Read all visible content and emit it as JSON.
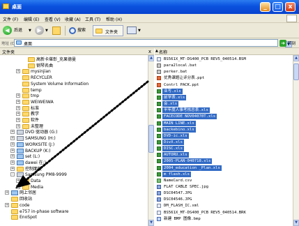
{
  "window": {
    "title": "桌面",
    "minimize_glyph": "_",
    "maximize_glyph": "□",
    "close_glyph": "x"
  },
  "menu": [
    "文件 (F)",
    "编辑 (E)",
    "查看 (V)",
    "收藏 (A)",
    "工具 (T)",
    "帮助 (H)"
  ],
  "toolbar": {
    "back_label": "后退",
    "search_label": "搜索",
    "folders_label": "文件夹"
  },
  "address": {
    "label": "地址 (D)",
    "value": "桌面",
    "go_label": "转到"
  },
  "folders_pane": {
    "title": "文件夹",
    "close_glyph": "x"
  },
  "tree": [
    {
      "label": "高新卡堪彰_充果德曼",
      "depth": 5,
      "icon": "folder",
      "expander": ""
    },
    {
      "label": "钢琴名曲",
      "depth": 5,
      "icon": "folder",
      "expander": ""
    },
    {
      "label": "mysinjian",
      "depth": 4,
      "icon": "folder",
      "expander": "+"
    },
    {
      "label": "RECYCLER",
      "depth": 4,
      "icon": "folder",
      "expander": ""
    },
    {
      "label": "System Volume Information",
      "depth": 4,
      "icon": "folder",
      "expander": ""
    },
    {
      "label": "temp",
      "depth": 4,
      "icon": "folder",
      "expander": ""
    },
    {
      "label": "tmp",
      "depth": 4,
      "icon": "folder",
      "expander": "+"
    },
    {
      "label": "WEIWEIWA",
      "depth": 4,
      "icon": "folder",
      "expander": "+"
    },
    {
      "label": "标准",
      "depth": 4,
      "icon": "folder",
      "expander": "+"
    },
    {
      "label": "教学",
      "depth": 4,
      "icon": "folder",
      "expander": "+"
    },
    {
      "label": "软件",
      "depth": 4,
      "icon": "folder",
      "expander": "+"
    },
    {
      "label": "未整理",
      "depth": 4,
      "icon": "folder",
      "expander": "+"
    },
    {
      "label": "DVD 驱动器 (G:)",
      "depth": 3,
      "icon": "drive",
      "expander": "+"
    },
    {
      "label": "SAMSUNG (H:)",
      "depth": 3,
      "icon": "drive",
      "expander": "+"
    },
    {
      "label": "WORKSITE (J:)",
      "depth": 3,
      "icon": "net",
      "expander": "+"
    },
    {
      "label": "BACKUP (K:)",
      "depth": 3,
      "icon": "net",
      "expander": "+"
    },
    {
      "label": "set (L:)",
      "depth": 3,
      "icon": "net",
      "expander": "+"
    },
    {
      "label": "dawei 在:)",
      "depth": 3,
      "icon": "net",
      "expander": "+"
    },
    {
      "label": "控制面板",
      "depth": 3,
      "icon": "folder",
      "expander": "+"
    },
    {
      "label": "Samsung PM8-9999",
      "depth": 3,
      "icon": "drive",
      "expander": "-"
    },
    {
      "label": "Data",
      "depth": 4,
      "icon": "folder",
      "expander": "+"
    },
    {
      "label": "Media",
      "depth": 4,
      "icon": "folder",
      "expander": "+"
    },
    {
      "label": "网上邻居",
      "depth": 2,
      "icon": "net",
      "expander": "+"
    },
    {
      "label": "回收站",
      "depth": 2,
      "icon": "folder",
      "expander": ""
    },
    {
      "label": "code",
      "depth": 2,
      "icon": "folder",
      "expander": "+"
    },
    {
      "label": "e757 in-phase software",
      "depth": 2,
      "icon": "folder",
      "expander": ""
    },
    {
      "label": "EnoSpot",
      "depth": 2,
      "icon": "folder",
      "expander": ""
    }
  ],
  "list_header": {
    "name": "名称",
    "sort_glyph": "▲"
  },
  "files": [
    {
      "name": "BS561X_MT-DS400_PCB REV5_040514.BSM",
      "icon": "doc",
      "selected": false
    },
    {
      "name": "para2local.bat",
      "icon": "bat",
      "selected": false
    },
    {
      "name": "perker.bat",
      "icon": "bat",
      "selected": false
    },
    {
      "name": "优秀课题让评分表.ppt",
      "icon": "ppt",
      "selected": false
    },
    {
      "name": "Contrl PACK.ppt",
      "icon": "ppt",
      "selected": false
    },
    {
      "name": "业写.xls",
      "icon": "xls",
      "selected": true
    },
    {
      "name": "前学表.xls",
      "icon": "xls",
      "selected": true
    },
    {
      "name": "会.xls",
      "icon": "xls",
      "selected": true
    },
    {
      "name": "半年度人事考核总表.xls",
      "icon": "xls",
      "selected": true
    },
    {
      "name": "FACECODE NOV04070T.xls",
      "icon": "xls",
      "selected": true
    },
    {
      "name": "MAIN LINE.xls",
      "icon": "xls",
      "selected": true
    },
    {
      "name": "backebino.xls",
      "icon": "xls",
      "selected": true
    },
    {
      "name": "DVD-ic.xls",
      "icon": "xls",
      "selected": true
    },
    {
      "name": "DivX.xls",
      "icon": "xls",
      "selected": true
    },
    {
      "name": "DISC.xls",
      "icon": "xls",
      "selected": true
    },
    {
      "name": "AUTORU.xls",
      "icon": "xls",
      "selected": true
    },
    {
      "name": "2005-PLAN-040718.xls",
      "icon": "xls",
      "selected": true
    },
    {
      "name": "2004_education _Plan.xls",
      "icon": "xls",
      "selected": true
    },
    {
      "name": "m flash.xls",
      "icon": "xls",
      "selected": true
    },
    {
      "name": "NameCard.csv",
      "icon": "csv",
      "selected": false
    },
    {
      "name": "FLAT CABLE SPEC.jpg",
      "icon": "jpg",
      "selected": false
    },
    {
      "name": "DSC04547.JPG",
      "icon": "jpg",
      "selected": false
    },
    {
      "name": "DSC04546.JPG",
      "icon": "jpg",
      "selected": false
    },
    {
      "name": "DM_FLASH_IC.xml",
      "icon": "doc",
      "selected": false
    },
    {
      "name": "BS561X_MT-DS400_PCB REV5_040514.BRK",
      "icon": "doc",
      "selected": false
    },
    {
      "name": "新建 BMP 图像.bmp",
      "icon": "bmp",
      "selected": false
    }
  ],
  "scroll": {
    "up_glyph": "▲",
    "down_glyph": "▼"
  }
}
